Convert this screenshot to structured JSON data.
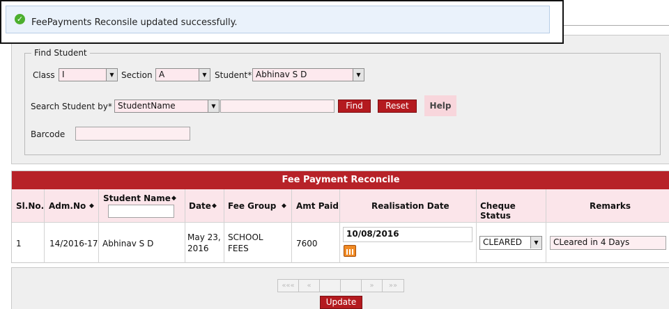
{
  "notice": {
    "message": "FeePayments Reconsile updated successfully."
  },
  "find_student": {
    "legend": "Find Student",
    "class_label": "Class",
    "class_value": "I",
    "section_label": "Section",
    "section_value": "A",
    "student_label": "Student*",
    "student_value": "Abhinav S D",
    "search_by_label": "Search Student by*",
    "search_by_value": "StudentName",
    "search_text": "",
    "find_label": "Find",
    "reset_label": "Reset",
    "help_label": "Help",
    "barcode_label": "Barcode",
    "barcode_value": ""
  },
  "table": {
    "title": "Fee Payment Reconcile",
    "headers": {
      "slno": "Sl.No.",
      "admno": "Adm.No",
      "student_name": "Student Name",
      "date": "Date",
      "fee_group": "Fee Group",
      "amt_paid": "Amt Paid",
      "realisation_date": "Realisation Date",
      "cheque_status": "Cheque Status",
      "remarks": "Remarks"
    },
    "rows": [
      {
        "slno": "1",
        "admno": "14/2016-17",
        "student_name": "Abhinav S D",
        "date_line1": "May 23,",
        "date_line2": "2016",
        "fee_group_line1": "SCHOOL",
        "fee_group_line2": "FEES",
        "amt_paid": "7600",
        "realisation_date": "10/08/2016",
        "cheque_status": "CLEARED",
        "remarks": "CLeared in 4 Days"
      }
    ]
  },
  "pager": {
    "first": "«««",
    "prev": "«",
    "next": "»",
    "last": "»»"
  },
  "update_label": "Update"
}
